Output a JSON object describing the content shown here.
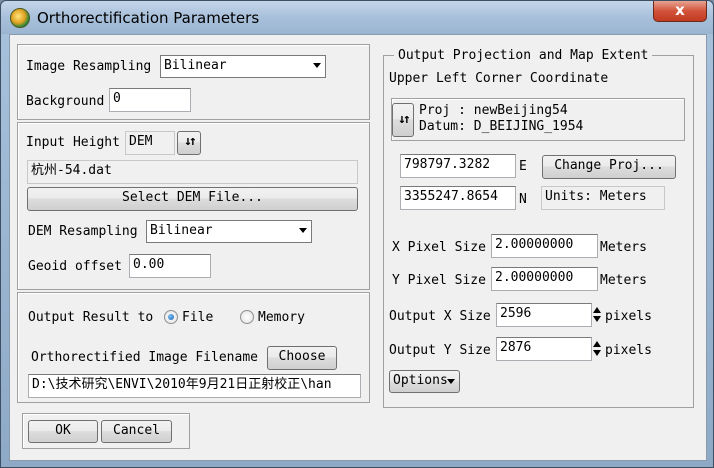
{
  "window": {
    "title": "Orthorectification Parameters",
    "close_glyph": "x"
  },
  "resampling": {
    "image_label": "Image Resampling",
    "image_value": "Bilinear",
    "background_label": "Background",
    "background_value": "0"
  },
  "dem": {
    "input_height_label": "Input Height",
    "input_height_value": "DEM",
    "toggle_glyph": "↓↑",
    "file_name": "杭州-54.dat",
    "select_button": "Select DEM File...",
    "resampling_label": "DEM Resampling",
    "resampling_value": "Bilinear",
    "geoid_label": "Geoid offset",
    "geoid_value": "0.00"
  },
  "output": {
    "result_label": "Output Result to",
    "file_option": "File",
    "memory_option": "Memory",
    "selected": "File",
    "filename_label": "Orthorectified Image Filename",
    "choose_button": "Choose",
    "filename_value": "D:\\技术研究\\ENVI\\2010年9月21日正射校正\\han"
  },
  "buttons": {
    "ok": "OK",
    "cancel": "Cancel"
  },
  "projection": {
    "group_title": "Output Projection and Map Extent",
    "corner_label": "Upper Left Corner Coordinate",
    "toggle_glyph": "↓↑",
    "proj_line": "Proj : newBeijing54",
    "datum_line": "Datum: D_BEIJING_1954",
    "easting_value": "798797.3282",
    "easting_unit": "E",
    "northing_value": "3355247.8654",
    "northing_unit": "N",
    "change_proj_button": "Change Proj...",
    "units_text": "Units: Meters",
    "x_pixel_label": "X Pixel Size",
    "x_pixel_value": "2.00000000",
    "x_pixel_unit": "Meters",
    "y_pixel_label": "Y Pixel Size",
    "y_pixel_value": "2.00000000",
    "y_pixel_unit": "Meters",
    "out_x_label": "Output X Size",
    "out_x_value": "2596",
    "out_x_unit": "pixels",
    "out_y_label": "Output Y Size",
    "out_y_value": "2876",
    "out_y_unit": "pixels",
    "options_button": "Options"
  }
}
